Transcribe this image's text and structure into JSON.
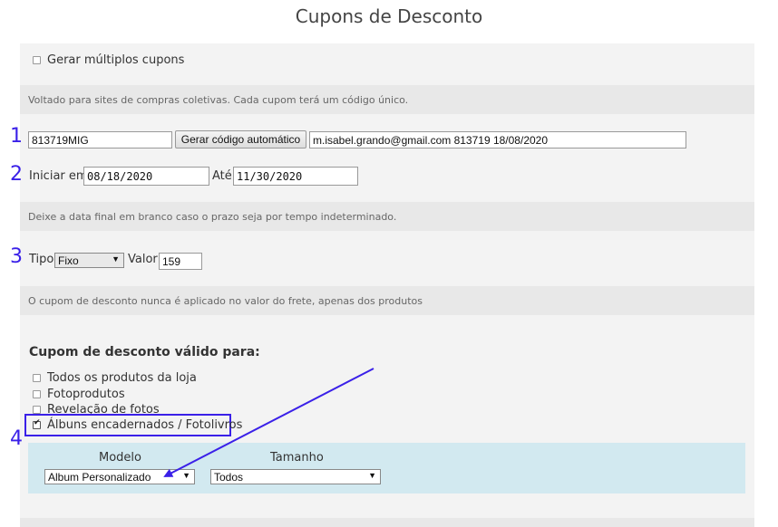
{
  "page_title": "Cupons de Desconto",
  "multiple": {
    "label": "Gerar múltiplos cupons",
    "hint": "Voltado para sites de compras coletivas. Cada cupom terá um código único."
  },
  "code": {
    "value": "813719MIG",
    "generate_label": "Gerar código automático",
    "description": "m.isabel.grando@gmail.com 813719 18/08/2020"
  },
  "dates": {
    "start_label": "Iniciar em",
    "start_value": "08/18/2020",
    "end_label": "Até",
    "end_value": "11/30/2020",
    "hint": "Deixe a data final em branco caso o prazo seja por tempo indeterminado."
  },
  "discount": {
    "type_label": "Tipo",
    "type_value": "Fixo",
    "value_label": "Valor",
    "value": "159",
    "hint": "O cupom de desconto nunca é aplicado no valor do frete, apenas dos produtos"
  },
  "valid_for": {
    "heading": "Cupom de desconto válido para:",
    "options": [
      {
        "label": "Todos os produtos da loja",
        "checked": false
      },
      {
        "label": "Fotoprodutos",
        "checked": false
      },
      {
        "label": "Revelação de fotos",
        "checked": false
      },
      {
        "label": "Álbuns encadernados / Fotolivros",
        "checked": true
      }
    ]
  },
  "album_filter": {
    "model_label": "Modelo",
    "model_value": "Album Personalizado",
    "size_label": "Tamanho",
    "size_value": "Todos"
  },
  "annotations": {
    "n1": "1",
    "n2": "2",
    "n3": "3",
    "n4": "4",
    "color": "#3a20e8"
  }
}
